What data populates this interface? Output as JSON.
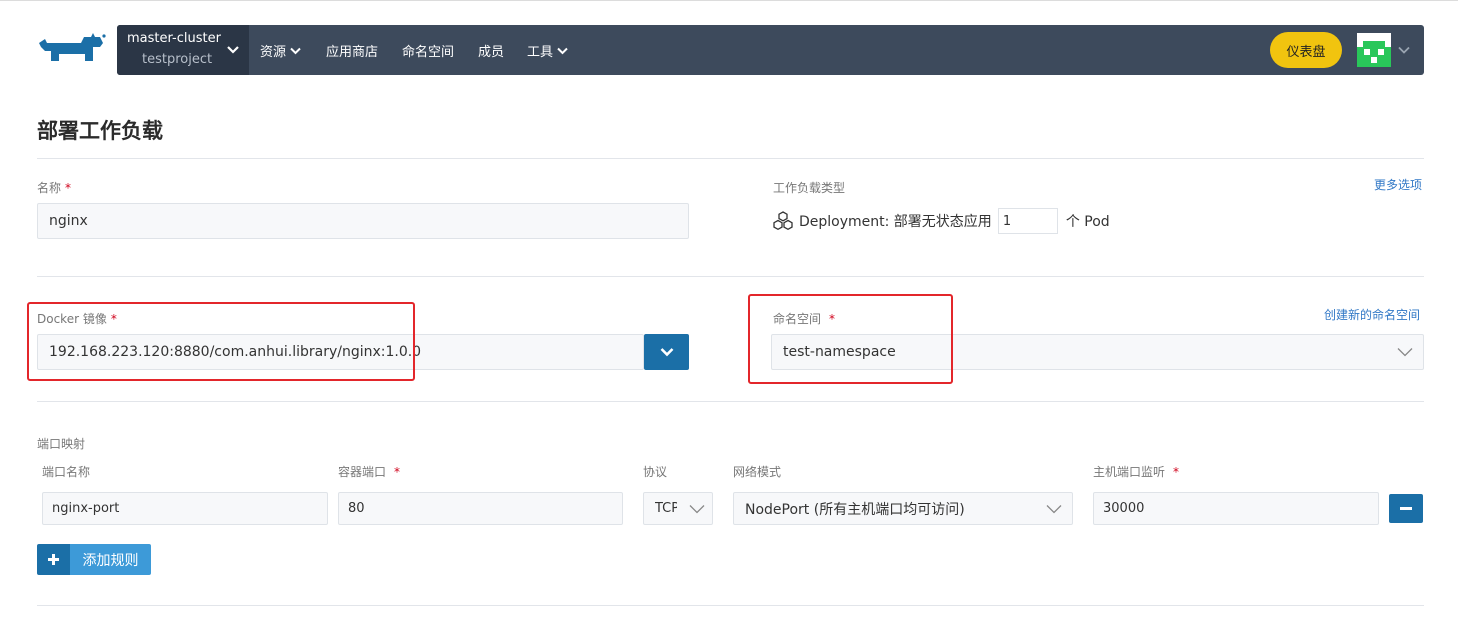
{
  "nav": {
    "cluster_name": "master-cluster",
    "project_name": "testproject",
    "items": [
      "资源",
      "应用商店",
      "命名空间",
      "成员",
      "工具"
    ],
    "dashboard_label": "仪表盘"
  },
  "page": {
    "title": "部署工作负载"
  },
  "form": {
    "name_label": "名称",
    "name_value": "nginx",
    "required_mark": "*",
    "workload_type_label": "工作负载类型",
    "more_options": "更多选项",
    "deployment_prefix": "Deployment: 部署无状态应用",
    "scale_value": "1",
    "pod_suffix": "个 Pod",
    "image_label": "Docker 镜像",
    "image_value": "192.168.223.120:8880/com.anhui.library/nginx:1.0.0",
    "namespace_label": "命名空间",
    "create_namespace": "创建新的命名空间",
    "namespace_value": "test-namespace"
  },
  "ports": {
    "section_label": "端口映射",
    "headers": {
      "port_name": "端口名称",
      "container_port": "容器端口",
      "protocol": "协议",
      "network_mode": "网络模式",
      "host_port": "主机端口监听"
    },
    "row": {
      "port_name": "nginx-port",
      "container_port": "80",
      "protocol": "TCP",
      "network_mode": "NodePort (所有主机端口均可访问)",
      "host_port": "30000"
    },
    "add_rule": "添加规则"
  },
  "colors": {
    "nav_bg": "#3d4a5c",
    "accent_blue": "#1b6fa7",
    "dashboard_yellow": "#f1c40f",
    "highlight_red": "#e3262b"
  }
}
